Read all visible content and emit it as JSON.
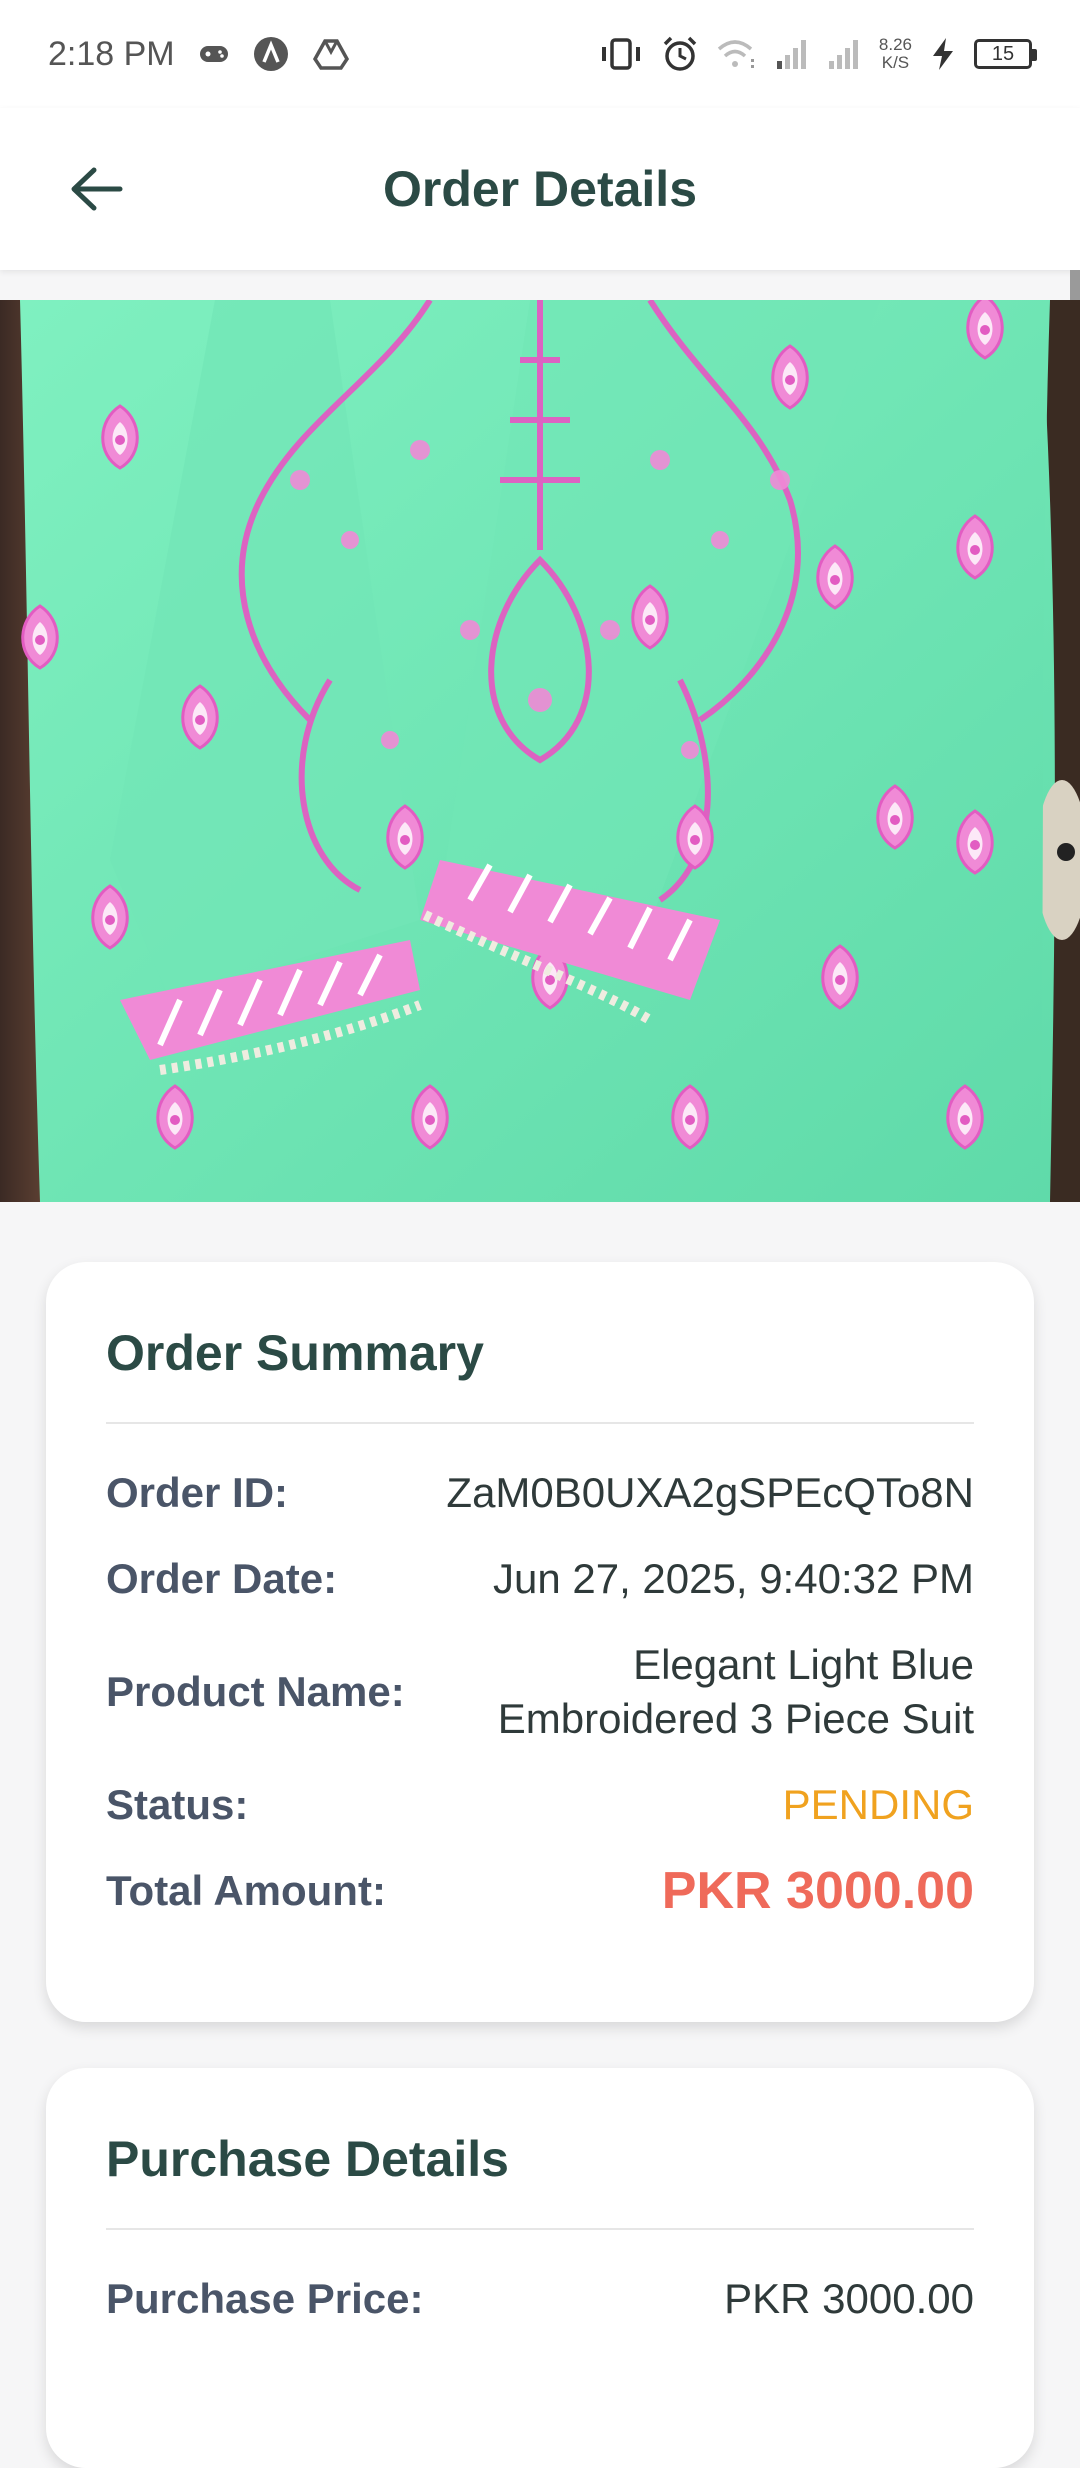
{
  "status_bar": {
    "time": "2:18 PM",
    "net_speed_value": "8.26",
    "net_speed_unit": "K/S",
    "battery_level": "15"
  },
  "app_bar": {
    "title": "Order Details"
  },
  "colors": {
    "accent_dark_green": "#2b4a45",
    "status_pending": "#f0a21f",
    "amount_red": "#ef6a5a",
    "product_mint": "#6ee6b3",
    "embroidery_pink": "#e86bc9"
  },
  "order_summary": {
    "title": "Order Summary",
    "order_id_label": "Order ID:",
    "order_id_value": "ZaM0B0UXA2gSPEcQTo8N",
    "order_date_label": "Order Date:",
    "order_date_value": "Jun 27, 2025, 9:40:32 PM",
    "product_name_label": "Product Name:",
    "product_name_value": "Elegant Light Blue Embroidered 3 Piece Suit",
    "status_label": "Status:",
    "status_value": "PENDING",
    "total_amount_label": "Total Amount:",
    "total_amount_value": "PKR 3000.00"
  },
  "purchase_details": {
    "title": "Purchase Details",
    "purchase_price_label": "Purchase Price:",
    "purchase_price_value": "PKR 3000.00"
  }
}
